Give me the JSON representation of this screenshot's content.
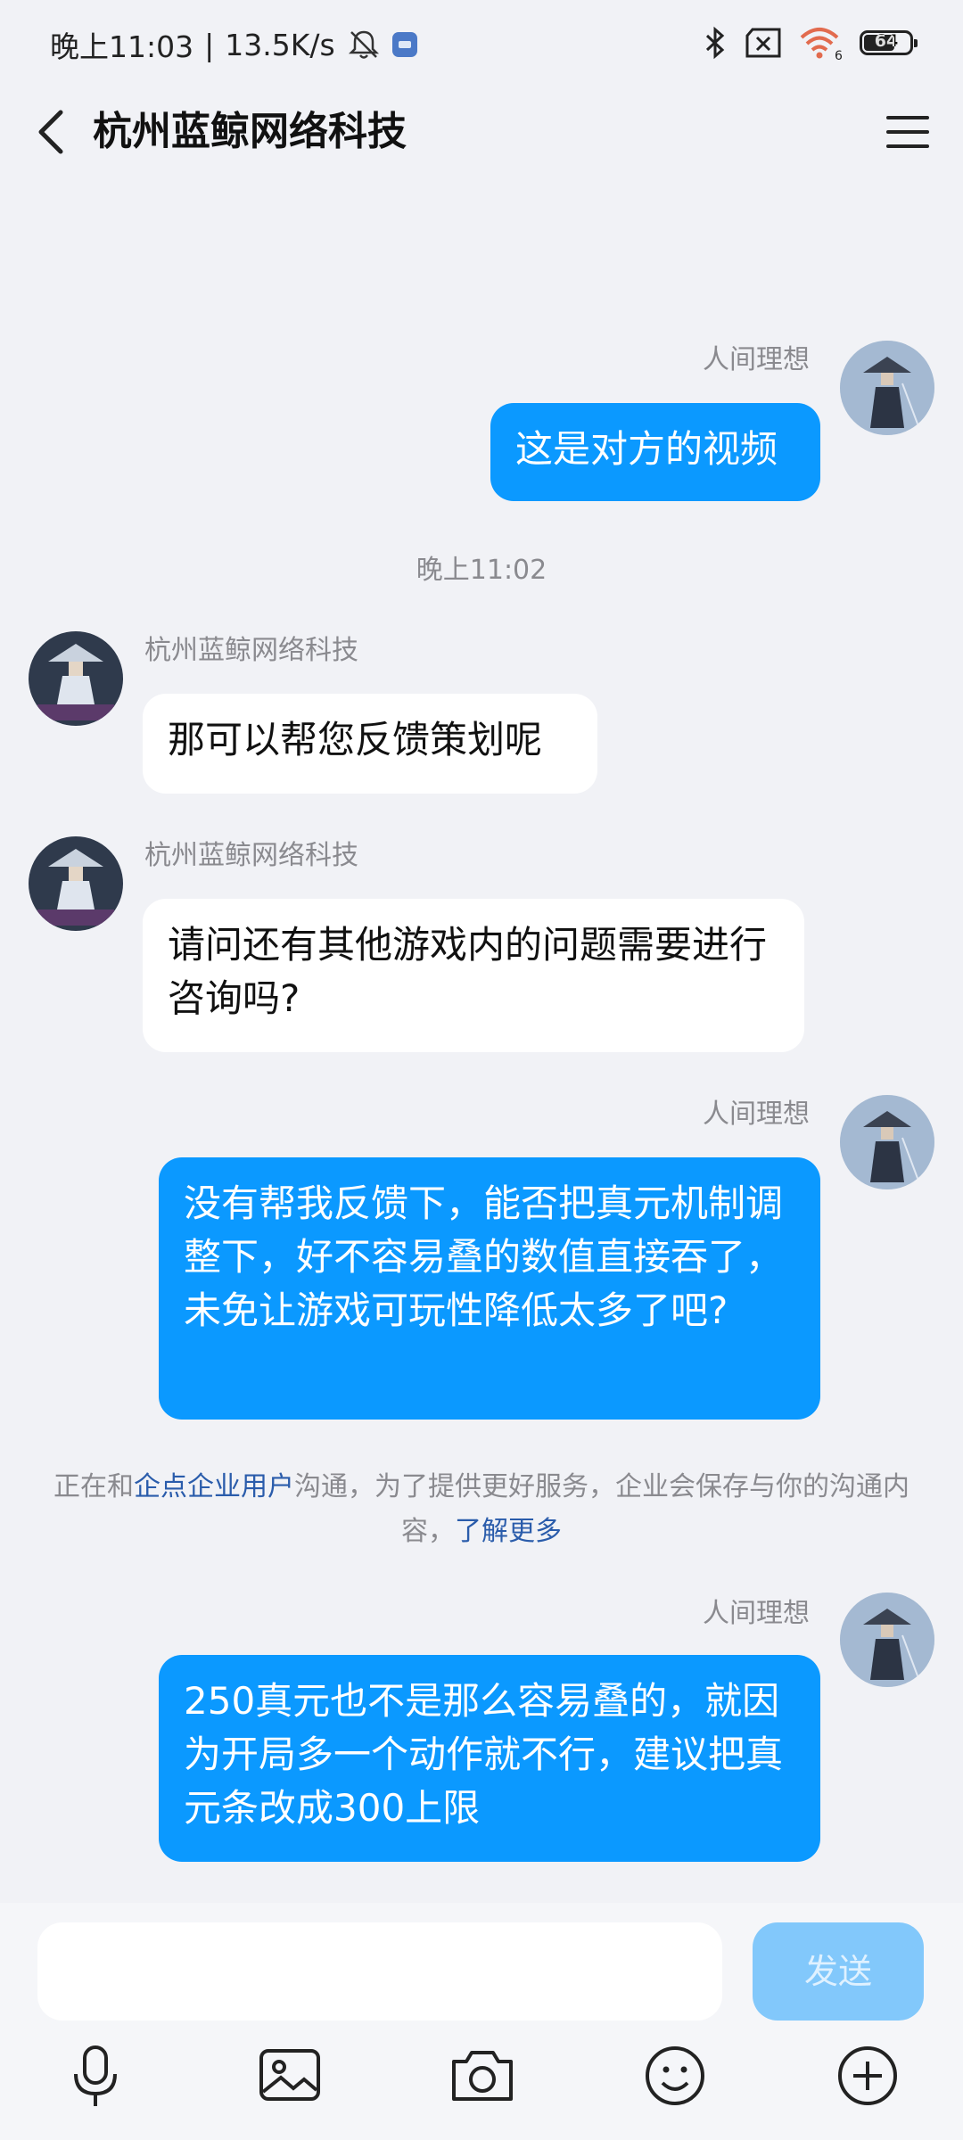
{
  "status_bar": {
    "time": "晚上11:03",
    "speed": "13.5K/s",
    "battery": "64"
  },
  "nav": {
    "title": "杭州蓝鲸网络科技"
  },
  "messages": [
    {
      "sender": "人间理想",
      "text": "这是对方的视频"
    },
    {
      "time": "晚上11:02"
    },
    {
      "sender": "杭州蓝鲸网络科技",
      "text": "那可以帮您反馈策划呢"
    },
    {
      "sender": "杭州蓝鲸网络科技",
      "text": "请问还有其他游戏内的问题需要进行咨询吗?"
    },
    {
      "sender": "人间理想",
      "text": "没有帮我反馈下，能否把真元机制调整下，好不容易叠的数值直接吞了，未免让游戏可玩性降低太多了吧?"
    },
    {
      "sender": "人间理想",
      "text": "250真元也不是那么容易叠的，就因为开局多一个动作就不行，建议把真元条改成300上限"
    }
  ],
  "notice": {
    "prefix": "正在和",
    "link1": "企点企业用户",
    "middle": "沟通，为了提供更好服务，企业会保存与你的沟通内容，",
    "link2": "了解更多"
  },
  "composer": {
    "send_label": "发送"
  },
  "colors": {
    "outgoing_bubble": "#0b99ff",
    "send_button_disabled": "#82c8fb",
    "link": "#2a5cab"
  },
  "icons": [
    "microphone-icon",
    "image-icon",
    "camera-icon",
    "emoji-icon",
    "plus-icon"
  ]
}
